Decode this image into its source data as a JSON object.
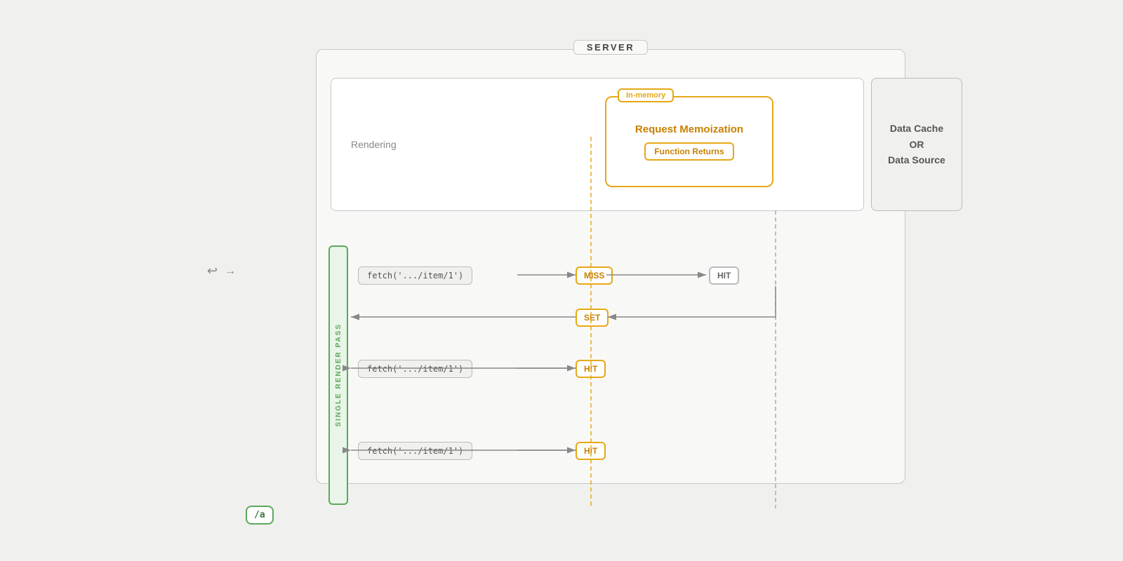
{
  "diagram": {
    "server_label": "SERVER",
    "rendering_label": "Rendering",
    "in_memory_label": "In-memory",
    "memo_title": "Request Memoization",
    "func_returns": "Function Returns",
    "data_cache_label": "Data Cache\nOR\nData Source",
    "route_a": "/a",
    "render_pass_text": "SINGLE RENDER PASS",
    "fetch1": "fetch('.../item/1')",
    "fetch2": "fetch('.../item/1')",
    "fetch3": "fetch('.../item/1')",
    "miss": "MISS",
    "set": "SET",
    "hit1": "HIT",
    "hit2": "HIT",
    "hit3": "HIT",
    "hit_ds": "HIT",
    "colors": {
      "green": "#5ca85c",
      "orange": "#e6a817",
      "orange_dark": "#c88000",
      "gray_border": "#bbb",
      "gray_bg": "#f0f0ee",
      "white": "#fff"
    }
  }
}
